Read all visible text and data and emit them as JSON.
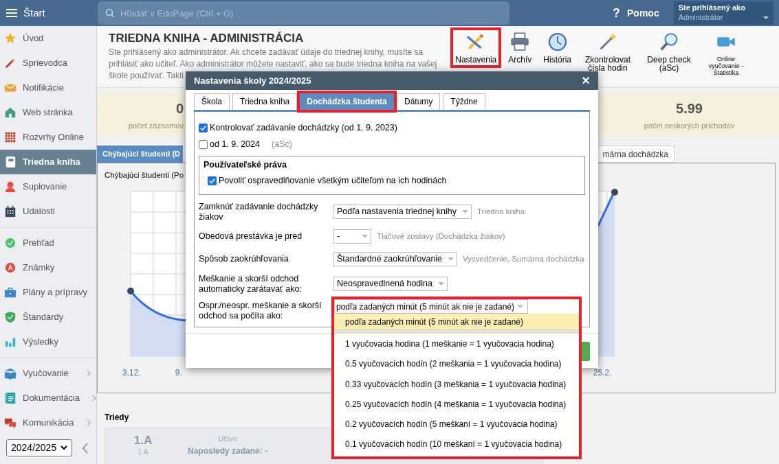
{
  "header": {
    "menu_label": "Štart",
    "search_placeholder": "Hľadať v EduPage (Ctrl + G)",
    "help_icon": "?",
    "help_label": "Pomoc",
    "login_title": "Ste prihlásený ako",
    "login_role": "Administrátor"
  },
  "sidebar": {
    "groups": [
      [
        {
          "label": "Úvod",
          "selected": false,
          "submenu": false
        },
        {
          "label": "Sprievodca",
          "selected": false,
          "submenu": false
        },
        {
          "label": "Notifikácie",
          "selected": false,
          "submenu": false
        },
        {
          "label": "Web stránka",
          "selected": false,
          "submenu": false
        },
        {
          "label": "Rozvrhy Online",
          "selected": false,
          "submenu": false
        },
        {
          "label": "Triedna kniha",
          "selected": true,
          "submenu": false
        },
        {
          "label": "Suplovanie",
          "selected": false,
          "submenu": false
        },
        {
          "label": "Udalosti",
          "selected": false,
          "submenu": false
        }
      ],
      [
        {
          "label": "Prehľad",
          "selected": false,
          "submenu": false
        },
        {
          "label": "Známky",
          "selected": false,
          "submenu": false
        },
        {
          "label": "Plány a prípravy",
          "selected": false,
          "submenu": false
        },
        {
          "label": "Štandardy",
          "selected": false,
          "submenu": false
        },
        {
          "label": "Výsledky",
          "selected": false,
          "submenu": false
        }
      ],
      [
        {
          "label": "Vyučovanie",
          "selected": false,
          "submenu": true
        },
        {
          "label": "Dokumentácia",
          "selected": false,
          "submenu": true
        },
        {
          "label": "Komunikácia",
          "selected": false,
          "submenu": true
        }
      ]
    ],
    "year_select": "2024/2025"
  },
  "page": {
    "title": "TRIEDNA KNIHA - ADMINISTRÁCIA",
    "description": "Ste prihlásený ako administrátor. Ak chcete zadávať údaje do triednej knihy, musíte sa\nprihlásiť ako učiteľ. Ako administrátor môžete nastaviť, ako sa bude triedna kniha na vašej\nškole používať. Takti",
    "tools": [
      {
        "label": "Nastavenia",
        "highlighted": true
      },
      {
        "label": "Archív",
        "highlighted": false
      },
      {
        "label": "História",
        "highlighted": false
      },
      {
        "label": "Zkontrolovat čísla hodin",
        "highlighted": false
      },
      {
        "label": "Deep check (aSc)",
        "highlighted": false
      },
      {
        "label": "Online vyučovanie - Štatistika",
        "highlighted": false
      }
    ]
  },
  "stats": [
    {
      "value": "0",
      "label": "počet záznamov"
    },
    {
      "value": "5.99",
      "label": "počet neskorých príchodov"
    }
  ],
  "tabs": [
    {
      "label": "Chýbajúci študenti (D",
      "selected": true
    },
    {
      "label": "márna dochádzka",
      "selected": false
    }
  ],
  "chart": {
    "title": "Chýbajúci študenti (Po",
    "x_labels": [
      "3.12.",
      "9.",
      "25.2."
    ]
  },
  "classes": {
    "title": "Triedy",
    "items": [
      {
        "name": "1.A",
        "short": "1.A",
        "subject_label": "Učivo",
        "last_entry": "Naposledy zadané: -"
      }
    ]
  },
  "dialog": {
    "title": "Nastavenia školy 2024/2025",
    "close": "×",
    "tabs": [
      {
        "label": "Škola",
        "selected": false,
        "highlighted": false
      },
      {
        "label": "Triedna kniha",
        "selected": false,
        "highlighted": false
      },
      {
        "label": "Dochádzka študenta",
        "selected": true,
        "highlighted": true
      },
      {
        "label": "Dátumy",
        "selected": false,
        "highlighted": false
      },
      {
        "label": "Týždne",
        "selected": false,
        "highlighted": false
      }
    ],
    "checks": [
      {
        "label": "Kontrolovať zadávanie dochádzky (od 1. 9. 2023)",
        "checked": true
      },
      {
        "label": "od 1. 9. 2024",
        "note": "(aSc)",
        "checked": false
      }
    ],
    "rights": {
      "title": "Používateľské práva",
      "checks": [
        {
          "label": "Povoliť ospravedlňovanie všetkým učiteľom na ich hodinách",
          "checked": true
        }
      ]
    },
    "rows": [
      {
        "label": "Zamknúť zadávanie dochádzky žiakov",
        "value": "Podľa nastavenia triednej knihy",
        "note": "Triedna kniha"
      },
      {
        "label": "Obedová prestávka je pred",
        "value": "-",
        "note": "Tlačové zostavy (Dochádzka žiakov)"
      },
      {
        "label": "Spôsob zaokrúhľovania",
        "value": "Štandardné zaokrúhľovanie",
        "note": "Vysvedčenie, Sumárna dochádzka"
      },
      {
        "label": "Meškanie a skorší odchod automaticky zarátavať ako:",
        "value": "Neospravedlnená hodina"
      },
      {
        "label": "Ospr./neospr. meškanie a skorší odchod sa počíta ako:"
      }
    ],
    "dropdown": {
      "value": "podľa zadaných minút (5 minút ak nie je zadané)",
      "highlighted": true,
      "options": [
        {
          "label": "podľa zadaných minút (5 minút ak nie je zadané)",
          "selected": true
        },
        {
          "label": "1 vyučovacia hodina (1 meškanie = 1 vyučovacia hodina)",
          "selected": false
        },
        {
          "label": "0.5 vyučovacích hodín (2 meškania = 1 vyučovacia hodina)",
          "selected": false
        },
        {
          "label": "0.33 vyučovacích hodín (3 meškania = 1 vyučovacia hodina)",
          "selected": false
        },
        {
          "label": "0.25 vyučovacích hodín (4 meškania = 1 vyučovacia hodina)",
          "selected": false
        },
        {
          "label": "0.2 vyučovacích hodín (5 meškaní = 1 vyučovacia hodina)",
          "selected": false
        },
        {
          "label": "0.1 vyučovacích hodín (10 meškaní = 1 vyučovacia hodina)",
          "selected": false
        }
      ]
    }
  }
}
